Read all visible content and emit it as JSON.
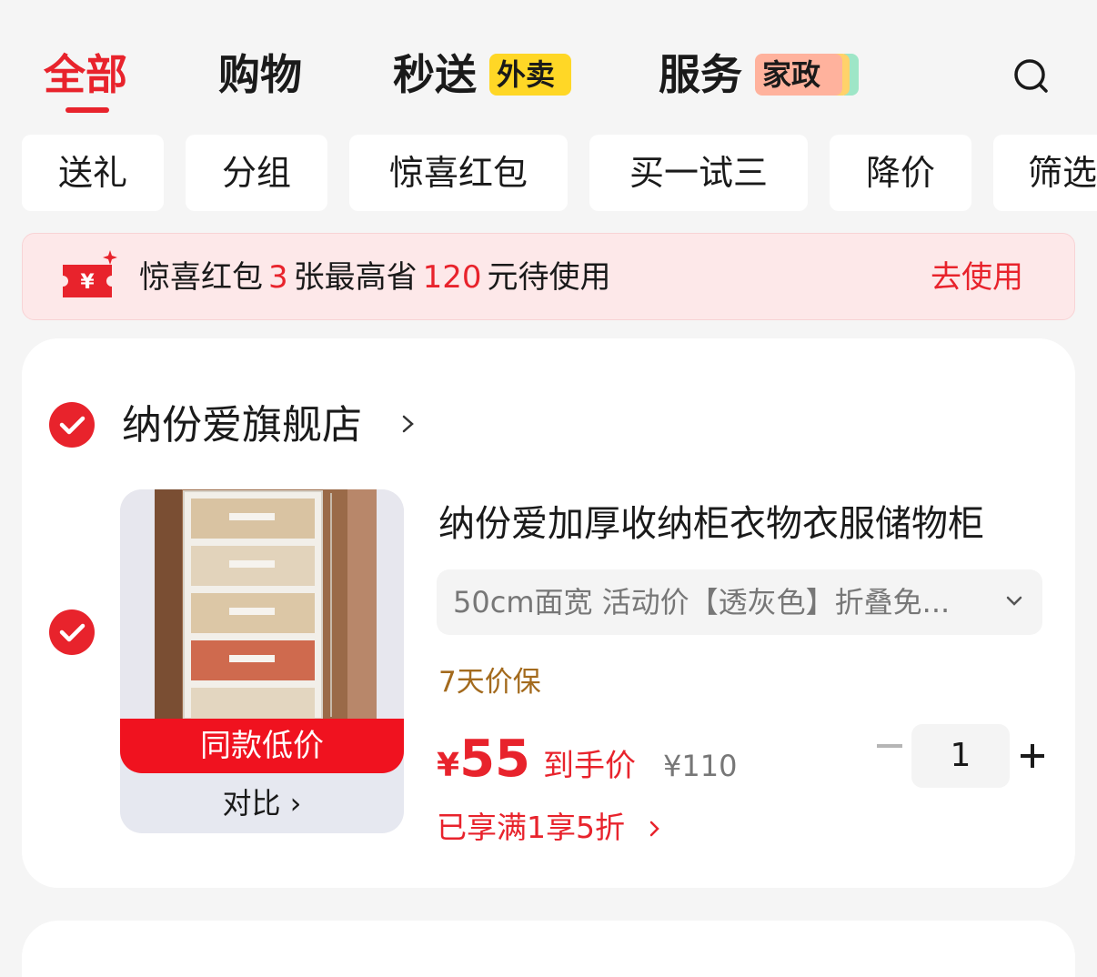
{
  "tabs": {
    "all": "全部",
    "shopping": "购物",
    "express": "秒送",
    "express_badge": "外卖",
    "services": "服务",
    "services_badge": "家政"
  },
  "chips": [
    "送礼",
    "分组",
    "惊喜红包",
    "买一试三",
    "降价",
    "筛选"
  ],
  "coupon": {
    "prefix": "惊喜红包",
    "count": "3",
    "middle": "张最高省",
    "amount": "120",
    "suffix": "元待使用",
    "action": "去使用",
    "icon_symbol": "¥"
  },
  "store": {
    "name": "纳份爱旗舰店"
  },
  "item": {
    "title": "纳份爱加厚收纳柜衣物衣服储物柜",
    "spec": "50cm面宽 活动价【透灰色】折叠免...",
    "guarantee": "7天价保",
    "currency": "¥",
    "price": "55",
    "price_suffix": "到手价",
    "original_price": "¥110",
    "promo": "已享满1享5折",
    "thumb_flag": "同款低价",
    "compare": "对比 ›",
    "quantity": "1"
  },
  "colors": {
    "brand_red": "#e8232c",
    "guarantee_brown": "#a36a1d",
    "takeout_badge": "#ffd726",
    "house_badge": "#ffb29d"
  }
}
